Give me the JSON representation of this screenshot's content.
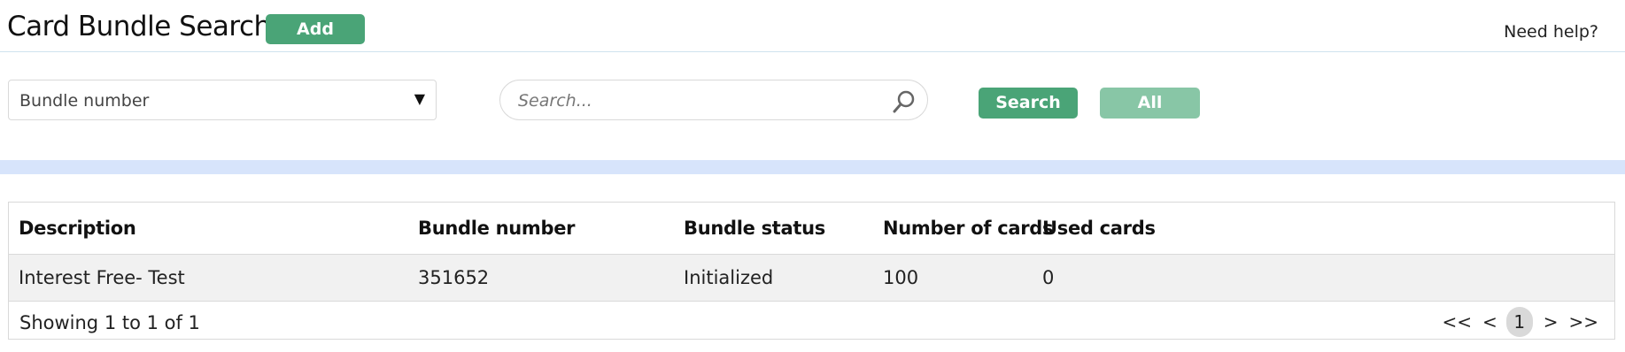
{
  "header": {
    "title": "Card Bundle Search",
    "add_label": "Add",
    "help_label": "Need help?"
  },
  "filters": {
    "select_value": "Bundle number",
    "search_placeholder": "Search...",
    "search_label": "Search",
    "all_label": "All"
  },
  "table": {
    "columns": [
      "Description",
      "Bundle number",
      "Bundle status",
      "Number of cards",
      "Used cards"
    ],
    "rows": [
      [
        "Interest Free- Test",
        "351652",
        "Initialized",
        "100",
        "0"
      ]
    ],
    "footer_text": "Showing 1 to 1 of 1",
    "pager": {
      "first": "<<",
      "prev": "<",
      "current": "1",
      "next": ">",
      "last": ">>"
    }
  },
  "colors": {
    "primary_button": "#4aa477",
    "disabled_button": "#88c6a6",
    "band": "#d7e4fb"
  },
  "icons": {
    "select_arrow": "▼",
    "search": "search-icon"
  }
}
